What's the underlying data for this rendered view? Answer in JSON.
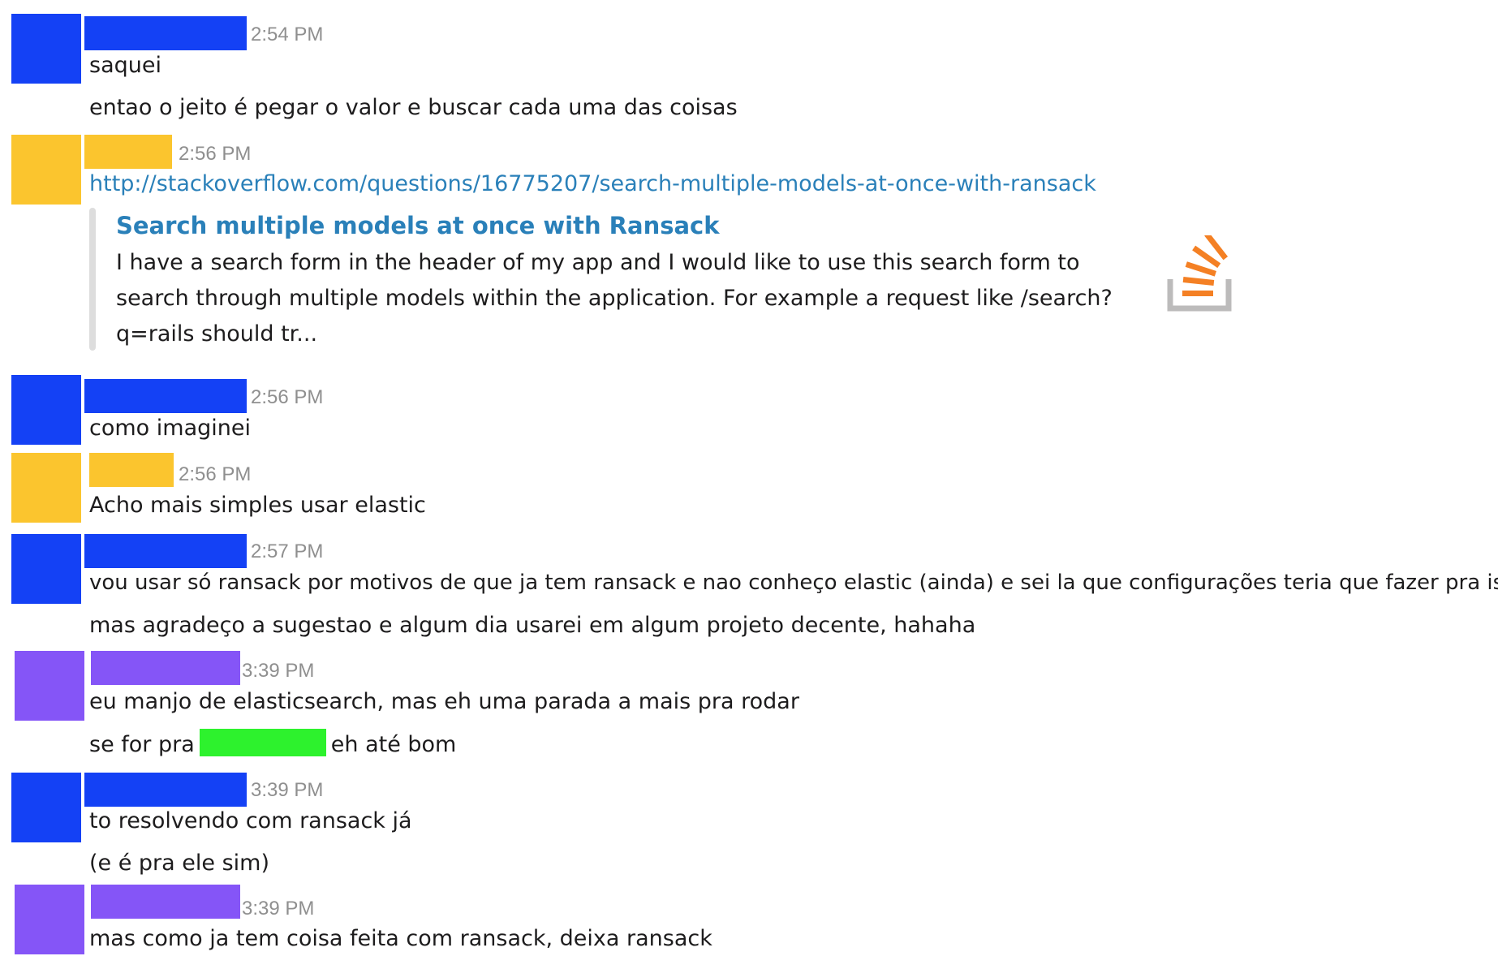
{
  "colors": {
    "user_a": "#1441f5",
    "user_b": "#fbc52e",
    "user_c": "#8555f7",
    "redacted_channel": "#2df22d",
    "link": "#2a80b9",
    "timestamp": "#8f8f8f"
  },
  "messages": [
    {
      "time": "2:54 PM",
      "lines": [
        "saquei",
        "entao o jeito é pegar o valor e buscar cada uma das coisas"
      ]
    },
    {
      "time": "2:56 PM",
      "link": "http://stackoverflow.com/questions/16775207/search-multiple-models-at-once-with-ransack"
    },
    {
      "time": "2:56 PM",
      "lines": [
        "como imaginei"
      ]
    },
    {
      "time": "2:56 PM",
      "lines": [
        "Acho mais simples usar elastic"
      ]
    },
    {
      "time": "2:57 PM",
      "lines": [
        "vou usar só ransack por motivos de que ja tem ransack e nao conheço elastic (ainda) e sei la que configurações teria que fazer pra isso",
        "mas agradeço a sugestao e algum dia usarei em algum projeto decente, hahaha"
      ]
    },
    {
      "time": "3:39 PM",
      "lines": [
        "eu manjo de elasticsearch, mas eh uma parada a mais pra rodar"
      ],
      "mixed": {
        "before": "se for pra",
        "after": "eh até bom"
      }
    },
    {
      "time": "3:39 PM",
      "lines": [
        "to resolvendo com ransack já",
        "(e é pra ele sim)"
      ]
    },
    {
      "time": "3:39 PM",
      "lines": [
        "mas como ja tem coisa feita com ransack, deixa ransack"
      ]
    }
  ],
  "unfurl": {
    "title": "Search multiple models at once with Ransack",
    "description": "I have a search form in the header of my app and I would like to use this search form to search through multiple models within the application. For example a request like /search?q=rails should tr...",
    "icon": "stackoverflow-icon"
  }
}
